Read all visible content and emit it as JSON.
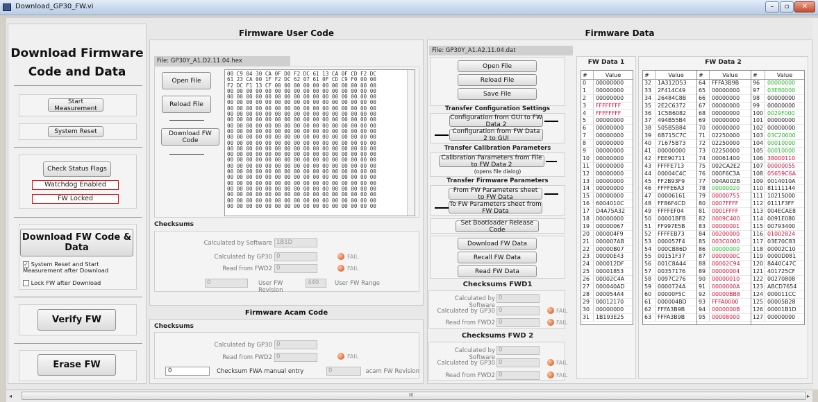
{
  "window": {
    "title": "Download_GP30_FW.vi",
    "min": "–",
    "max": "▫",
    "close": "✕"
  },
  "left": {
    "title_line1": "Download Firmware",
    "title_line2": "Code and Data",
    "start": "Start Measurement",
    "reset": "System Reset",
    "check": "Check Status Flags",
    "watchdog": "Watchdog Enabled",
    "fwlocked": "FW Locked",
    "download": "Download FW Code & Data",
    "chk1": "System Reset and Start Measurement after Download",
    "chk1_checked": "✓",
    "chk2": "Lock FW after Download",
    "verify": "Verify FW",
    "erase": "Erase FW"
  },
  "user": {
    "title": "Firmware User Code",
    "file": "File:  GP30Y_A1.D2.11.04.hex",
    "open": "Open File",
    "reload": "Reload File",
    "download": "Download FW Code",
    "hex": "00 C9 04 30 CA 0F D0 F2 DC 61 13 CA 0F CD F2 DC\n61 23 CA 00 1F F2 DC 62 07 61 0F CD C9 F0 00 00\nF2 DC F1 13 CF 00 00 00 00 00 00 00 00 00 00 00\n00 00 00 00 00 00 00 00 00 00 00 00 00 00 00 00\n00 00 00 00 00 00 00 00 00 00 00 00 00 00 00 00\n00 00 00 00 00 00 00 00 00 00 00 00 00 00 00 00\n00 00 00 00 00 00 00 00 00 00 00 00 00 00 00 00\n00 00 00 00 00 00 00 00 00 00 00 00 00 00 00 00\n00 00 00 00 00 00 00 00 00 00 00 00 00 00 00 00\n00 00 00 00 00 00 00 00 00 00 00 00 00 00 00 00\n00 00 00 00 00 00 00 00 00 00 00 00 00 00 00 00\n00 00 00 00 00 00 00 00 00 00 00 00 00 00 00 00\n00 00 00 00 00 00 00 00 00 00 00 00 00 00 00 00\n00 00 00 00 00 00 00 00 00 00 00 00 00 00 00 00\n00 00 00 00 00 00 00 00 00 00 00 00 00 00 00 00\n00 00 00 00 00 00 00 00 00 00 00 00 00 00 00 00\n00 00 00 00 00 00 00 00 00 00 00 00 00 00 00 00\n00 00 00 00 00 00 00 00 00 00 00 00 00 00 00 00\n00 00 00 00 00 00 00 00 00 00 00 00 00 00 00 00\n00 00 00 00 00 00 00 00 00 00 00 00 00 00 00 00\n00 00 00 00 00 00 00 00 00 00 00 00 00 00 00 00\n00 00 00 00 00 00 00 00 00 00 00 00 00 00 00 00\n00 00 00 00 00 00 00 00 00 00 00 00 00 00 00 00\n00 00 00 00 00 00 00 00 00 00 00 00 00 00 00 00",
    "checksums": "Checksums",
    "calc_sw": "Calculated by Software",
    "calc_sw_val": "1B1D",
    "calc_gp30": "Calculated by GP30",
    "calc_gp30_val": "0",
    "read_fwd2": "Read from FWD2",
    "read_fwd2_val": "0",
    "fail": "FAIL",
    "rev_val": "0",
    "rev_lbl": "User FW Revision",
    "range_val": "440",
    "range_lbl": "User FW Range"
  },
  "acam": {
    "title": "Firmware Acam Code",
    "checksums": "Checksums",
    "calc_gp30": "Calculated by GP30",
    "calc_gp30_val": "0",
    "read_fwd2": "Read from FWD2",
    "read_fwd2_val": "0",
    "fail": "FAIL",
    "manual_val": "0",
    "manual_lbl": "Checksum FWA manual entry",
    "rev_val": "0",
    "rev_lbl": "acam FW Revision"
  },
  "data": {
    "title": "Firmware Data",
    "file": "File:  GP30Y_A1.A2.11.04.dat",
    "open": "Open File",
    "reload": "Reload File",
    "save": "Save File",
    "tcs": "Transfer Configuration Settings",
    "gui_fw": "Configuration from GUI to FW Data 2",
    "fw_gui": "Configuration from FW Data 2 to GUI",
    "tcp": "Transfer Calibration Parameters",
    "cal": "Calibration Parameters from File to FW Data 2",
    "cal_note": "(opens file dialog)",
    "tfp": "Transfer Firmware Parameters",
    "fp_to": "From FW Parameters sheet to FW Data",
    "fp_from": "To FW Parameters sheet from FW Data",
    "boot": "Set Bootloader Release Code",
    "dl": "Download FW Data",
    "recall": "Recall FW Data",
    "read": "Read FW Data",
    "ck1": "Checksums FWD1",
    "ck2": "Checksums FWD 2",
    "calc_sw": "Calculated by Software",
    "calc_gp30": "Calculated by GP30",
    "read_fwd2": "Read from FWD2",
    "zero": "0",
    "fail": "FAIL"
  },
  "fw1": {
    "title": "FW Data 1",
    "hash": "#",
    "value": "Value",
    "rows": [
      [
        "0",
        "00000000",
        "k"
      ],
      [
        "1",
        "00000000",
        "k"
      ],
      [
        "2",
        "00000000",
        "k"
      ],
      [
        "3",
        "FFFFFFFF",
        "r"
      ],
      [
        "4",
        "FFFFFFFF",
        "r"
      ],
      [
        "5",
        "00000000",
        "k"
      ],
      [
        "6",
        "00000000",
        "k"
      ],
      [
        "7",
        "00000000",
        "k"
      ],
      [
        "8",
        "00000000",
        "k"
      ],
      [
        "9",
        "00000000",
        "k"
      ],
      [
        "10",
        "00000000",
        "k"
      ],
      [
        "11",
        "00000000",
        "k"
      ],
      [
        "12",
        "00000000",
        "k"
      ],
      [
        "13",
        "00000000",
        "k"
      ],
      [
        "14",
        "00000000",
        "k"
      ],
      [
        "15",
        "00000000",
        "k"
      ],
      [
        "16",
        "6004010C",
        "k"
      ],
      [
        "17",
        "D4A75A32",
        "k"
      ],
      [
        "18",
        "00000000",
        "k"
      ],
      [
        "19",
        "00000067",
        "k"
      ],
      [
        "20",
        "000004F9",
        "k"
      ],
      [
        "21",
        "000007AB",
        "k"
      ],
      [
        "22",
        "00000B07",
        "k"
      ],
      [
        "23",
        "00000E43",
        "k"
      ],
      [
        "24",
        "000012DF",
        "k"
      ],
      [
        "25",
        "00001853",
        "k"
      ],
      [
        "26",
        "00002C4A",
        "k"
      ],
      [
        "27",
        "000040AD",
        "k"
      ],
      [
        "28",
        "000054A4",
        "k"
      ],
      [
        "29",
        "00012170",
        "k"
      ],
      [
        "30",
        "00000000",
        "k"
      ],
      [
        "31",
        "1B193E25",
        "k"
      ]
    ]
  },
  "fw2": {
    "title": "FW Data 2",
    "hash": "#",
    "value": "Value",
    "col1": [
      [
        "32",
        "1A312D53",
        "k"
      ],
      [
        "33",
        "2F414C49",
        "k"
      ],
      [
        "34",
        "26484C8B",
        "k"
      ],
      [
        "35",
        "2E2C6372",
        "k"
      ],
      [
        "36",
        "1C5B6082",
        "k"
      ],
      [
        "37",
        "494B55B4",
        "k"
      ],
      [
        "38",
        "505B5B84",
        "k"
      ],
      [
        "39",
        "6B715C7C",
        "k"
      ],
      [
        "40",
        "71675B73",
        "k"
      ],
      [
        "41",
        "00000000",
        "k"
      ],
      [
        "42",
        "FEE90711",
        "k"
      ],
      [
        "43",
        "FFFFE713",
        "k"
      ],
      [
        "44",
        "00004C4C",
        "k"
      ],
      [
        "45",
        "FF2B93F9",
        "k"
      ],
      [
        "46",
        "FFFFE6A3",
        "k"
      ],
      [
        "47",
        "00006161",
        "k"
      ],
      [
        "48",
        "FF86F4CD",
        "k"
      ],
      [
        "49",
        "FFFFEF04",
        "k"
      ],
      [
        "50",
        "00001BFB",
        "k"
      ],
      [
        "51",
        "FF997E5B",
        "k"
      ],
      [
        "52",
        "FFFFEB73",
        "k"
      ],
      [
        "53",
        "000057F4",
        "k"
      ],
      [
        "54",
        "000CB86D",
        "k"
      ],
      [
        "55",
        "00151F37",
        "k"
      ],
      [
        "56",
        "001C8A44",
        "k"
      ],
      [
        "57",
        "00357176",
        "k"
      ],
      [
        "58",
        "0097C276",
        "k"
      ],
      [
        "59",
        "0000724A",
        "k"
      ],
      [
        "60",
        "00000F5C",
        "k"
      ],
      [
        "61",
        "000004BD",
        "k"
      ],
      [
        "62",
        "FFFA3B9B",
        "k"
      ],
      [
        "63",
        "FFFA3B9B",
        "k"
      ]
    ],
    "col2": [
      [
        "64",
        "FFFA3B9B",
        "k"
      ],
      [
        "65",
        "00000000",
        "k"
      ],
      [
        "66",
        "00000000",
        "k"
      ],
      [
        "67",
        "00000000",
        "k"
      ],
      [
        "68",
        "00000000",
        "k"
      ],
      [
        "69",
        "00000000",
        "k"
      ],
      [
        "70",
        "00000000",
        "k"
      ],
      [
        "71",
        "02250000",
        "k"
      ],
      [
        "72",
        "02250000",
        "k"
      ],
      [
        "73",
        "02250000",
        "k"
      ],
      [
        "74",
        "00061400",
        "k"
      ],
      [
        "75",
        "002CA2E2",
        "k"
      ],
      [
        "76",
        "000F6C3A",
        "k"
      ],
      [
        "77",
        "004A002B",
        "k"
      ],
      [
        "78",
        "00000020",
        "g"
      ],
      [
        "79",
        "00000755",
        "r"
      ],
      [
        "80",
        "0007FFFF",
        "r"
      ],
      [
        "81",
        "0001FFFF",
        "r"
      ],
      [
        "82",
        "0009C400",
        "r"
      ],
      [
        "83",
        "00000001",
        "r"
      ],
      [
        "84",
        "00200000",
        "r"
      ],
      [
        "85",
        "003C0000",
        "r"
      ],
      [
        "86",
        "00000000",
        "g"
      ],
      [
        "87",
        "0000000C",
        "r"
      ],
      [
        "88",
        "00002C94",
        "r"
      ],
      [
        "89",
        "00000004",
        "r"
      ],
      [
        "90",
        "00000010",
        "r"
      ],
      [
        "91",
        "0000000A",
        "r"
      ],
      [
        "92",
        "00000BB8",
        "r"
      ],
      [
        "93",
        "FFFA0000",
        "r"
      ],
      [
        "94",
        "0000000B",
        "r"
      ],
      [
        "95",
        "00008000",
        "r"
      ]
    ],
    "col3": [
      [
        "96",
        "00000000",
        "g"
      ],
      [
        "97",
        "03E80000",
        "g"
      ],
      [
        "98",
        "00000000",
        "k"
      ],
      [
        "99",
        "00000000",
        "k"
      ],
      [
        "100",
        "0029F000",
        "g"
      ],
      [
        "101",
        "00000000",
        "k"
      ],
      [
        "102",
        "00000000",
        "k"
      ],
      [
        "103",
        "03C20000",
        "g"
      ],
      [
        "104",
        "00010000",
        "g"
      ],
      [
        "105",
        "00010000",
        "g"
      ],
      [
        "106",
        "38000110",
        "r"
      ],
      [
        "107",
        "00000055",
        "r"
      ],
      [
        "108",
        "05659C6A",
        "r"
      ],
      [
        "109",
        "0014010A",
        "k"
      ],
      [
        "110",
        "81111144",
        "k"
      ],
      [
        "111",
        "10215000",
        "k"
      ],
      [
        "112",
        "0111F3FF",
        "k"
      ],
      [
        "113",
        "004ECAE8",
        "k"
      ],
      [
        "114",
        "0091E080",
        "k"
      ],
      [
        "115",
        "00793400",
        "k"
      ],
      [
        "116",
        "01002824",
        "r"
      ],
      [
        "117",
        "03E70C83",
        "k"
      ],
      [
        "118",
        "00002C10",
        "k"
      ],
      [
        "119",
        "0000D081",
        "k"
      ],
      [
        "120",
        "8A40C47C",
        "k"
      ],
      [
        "121",
        "401725CF",
        "k"
      ],
      [
        "122",
        "00270808",
        "k"
      ],
      [
        "123",
        "ABCD7654",
        "k"
      ],
      [
        "124",
        "000011CC",
        "k"
      ],
      [
        "125",
        "00005B28",
        "k"
      ],
      [
        "126",
        "00001B1D",
        "k"
      ],
      [
        "127",
        "00000000",
        "k"
      ]
    ]
  },
  "colors": {
    "k": "#222222",
    "r": "#d0103a",
    "g": "#22b822"
  },
  "scroll": {
    "label": "III"
  }
}
